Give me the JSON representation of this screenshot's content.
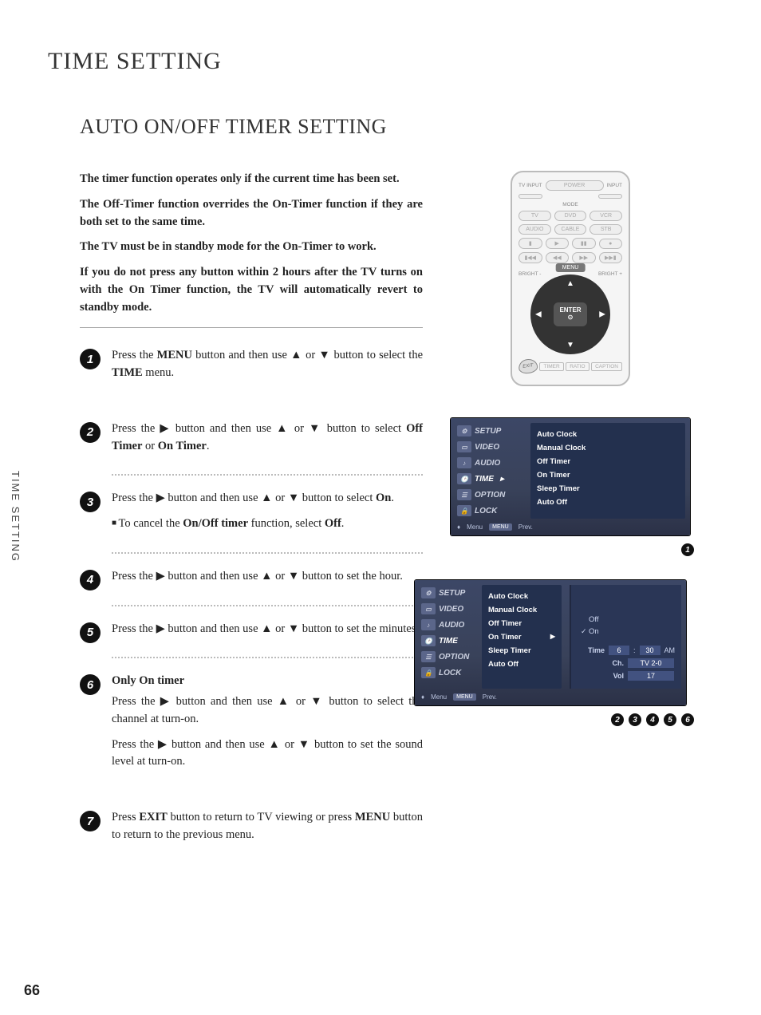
{
  "page_number": "66",
  "side_tab": "TIME SETTING",
  "main_title": "TIME SETTING",
  "section_title": "AUTO ON/OFF TIMER SETTING",
  "intro": [
    "The timer function operates only if the current time has been set.",
    "The Off-Timer function overrides the On-Timer function if they are both set to the same time.",
    "The TV must be in standby mode for the On-Timer to work.",
    "If you do not press any button within 2 hours after the TV turns on with the On Timer function, the TV will automatically revert to standby mode."
  ],
  "steps": {
    "s1_a": "Press the ",
    "s1_b": "MENU",
    "s1_c": " button and then use ▲ or ▼ button to select the ",
    "s1_d": "TIME",
    "s1_e": " menu.",
    "s2_a": "Press the ▶ button and then use ▲ or ▼ button to select ",
    "s2_b": "Off Timer",
    "s2_c": " or ",
    "s2_d": "On Timer",
    "s2_e": ".",
    "s3_a": "Press the ▶ button and then use ▲ or ▼ button to select ",
    "s3_b": "On",
    "s3_c": ".",
    "s3_sub_a": "To cancel the ",
    "s3_sub_b": "On/Off timer",
    "s3_sub_c": " function, select ",
    "s3_sub_d": "Off",
    "s3_sub_e": ".",
    "s4": "Press the ▶ button and then use ▲ or ▼ button to set the hour.",
    "s5": "Press the ▶ button and then use ▲ or ▼ button to set the minutes.",
    "s6_title": "Only On timer",
    "s6a": "Press the ▶ button and then use ▲ or ▼ button to select the channel at turn-on.",
    "s6b": "Press the ▶ button and then use ▲ or ▼ button to set the sound level at turn-on.",
    "s7_a": "Press ",
    "s7_b": "EXIT",
    "s7_c": " button to return to TV viewing or press ",
    "s7_d": "MENU",
    "s7_e": " button to return to the previous menu."
  },
  "remote": {
    "top_left": "TV INPUT",
    "top_right": "INPUT",
    "power": "POWER",
    "mode": "MODE",
    "row2": [
      "TV",
      "DVD",
      "VCR"
    ],
    "row3": [
      "AUDIO",
      "CABLE",
      "STB"
    ],
    "bright_minus": "BRIGHT -",
    "bright_plus": "BRIGHT +",
    "menu": "MENU",
    "enter": "ENTER",
    "enter_sym": "⊙",
    "exit": "EXIT",
    "bottom": [
      "TIMER",
      "RATIO",
      "CAPTION"
    ]
  },
  "osd_nav": [
    "SETUP",
    "VIDEO",
    "AUDIO",
    "TIME",
    "OPTION",
    "LOCK"
  ],
  "osd_items": [
    "Auto Clock",
    "Manual Clock",
    "Off Timer",
    "On Timer",
    "Sleep Timer",
    "Auto Off"
  ],
  "osd_footer": {
    "menu": "Menu",
    "prev": "Prev."
  },
  "osd2_sub": {
    "off": "Off",
    "on": "On",
    "time_lbl": "Time",
    "hour": "6",
    "minute": "30",
    "ampm": "AM",
    "ch_lbl": "Ch.",
    "ch_val": "TV  2-0",
    "vol_lbl": "Vol",
    "vol_val": "17"
  },
  "ref1": [
    "1"
  ],
  "ref2": [
    "2",
    "3",
    "4",
    "5",
    "6"
  ]
}
